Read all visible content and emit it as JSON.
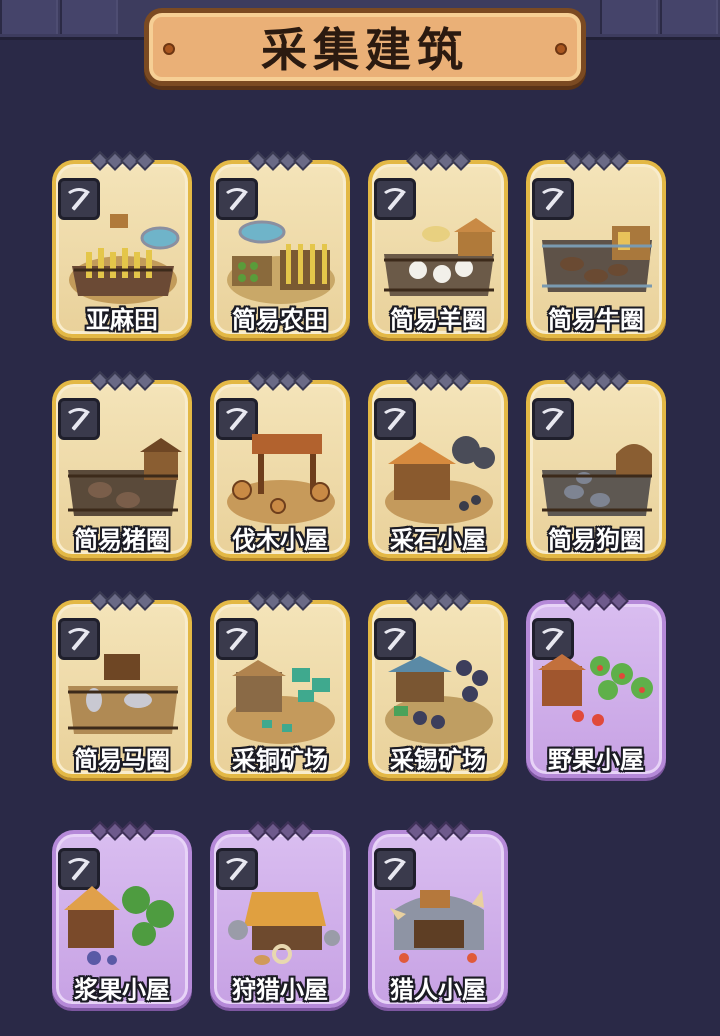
{
  "title": "采集建筑",
  "colors": {
    "background": "#2a2947",
    "banner": "#eab077",
    "card_gold": "#e3b845",
    "card_purple": "#b589d8"
  },
  "buildings": [
    {
      "label": "亚麻田",
      "icon": "pickaxe-icon",
      "frame": "gold",
      "art": "flax-field"
    },
    {
      "label": "简易农田",
      "icon": "pickaxe-icon",
      "frame": "gold",
      "art": "farmland"
    },
    {
      "label": "简易羊圈",
      "icon": "pickaxe-icon",
      "frame": "gold",
      "art": "sheep-pen"
    },
    {
      "label": "简易牛圈",
      "icon": "pickaxe-icon",
      "frame": "gold",
      "art": "cattle-pen"
    },
    {
      "label": "简易猪圈",
      "icon": "pickaxe-icon",
      "frame": "gold",
      "art": "pig-pen"
    },
    {
      "label": "伐木小屋",
      "icon": "pickaxe-icon",
      "frame": "gold",
      "art": "lumber-hut"
    },
    {
      "label": "采石小屋",
      "icon": "pickaxe-icon",
      "frame": "gold",
      "art": "quarry-hut"
    },
    {
      "label": "简易狗圈",
      "icon": "pickaxe-icon",
      "frame": "gold",
      "art": "dog-pen"
    },
    {
      "label": "简易马圈",
      "icon": "pickaxe-icon",
      "frame": "gold",
      "art": "horse-pen"
    },
    {
      "label": "采铜矿场",
      "icon": "pickaxe-icon",
      "frame": "gold",
      "art": "copper-mine"
    },
    {
      "label": "采锡矿场",
      "icon": "pickaxe-icon",
      "frame": "gold",
      "art": "tin-mine"
    },
    {
      "label": "野果小屋",
      "icon": "pickaxe-icon",
      "frame": "purple",
      "art": "wild-fruit-hut"
    },
    {
      "label": "浆果小屋",
      "icon": "pickaxe-icon",
      "frame": "purple",
      "art": "berry-hut"
    },
    {
      "label": "狩猎小屋",
      "icon": "pickaxe-icon",
      "frame": "purple",
      "art": "hunting-hut"
    },
    {
      "label": "猎人小屋",
      "icon": "pickaxe-icon",
      "frame": "purple",
      "art": "hunter-hut"
    }
  ]
}
